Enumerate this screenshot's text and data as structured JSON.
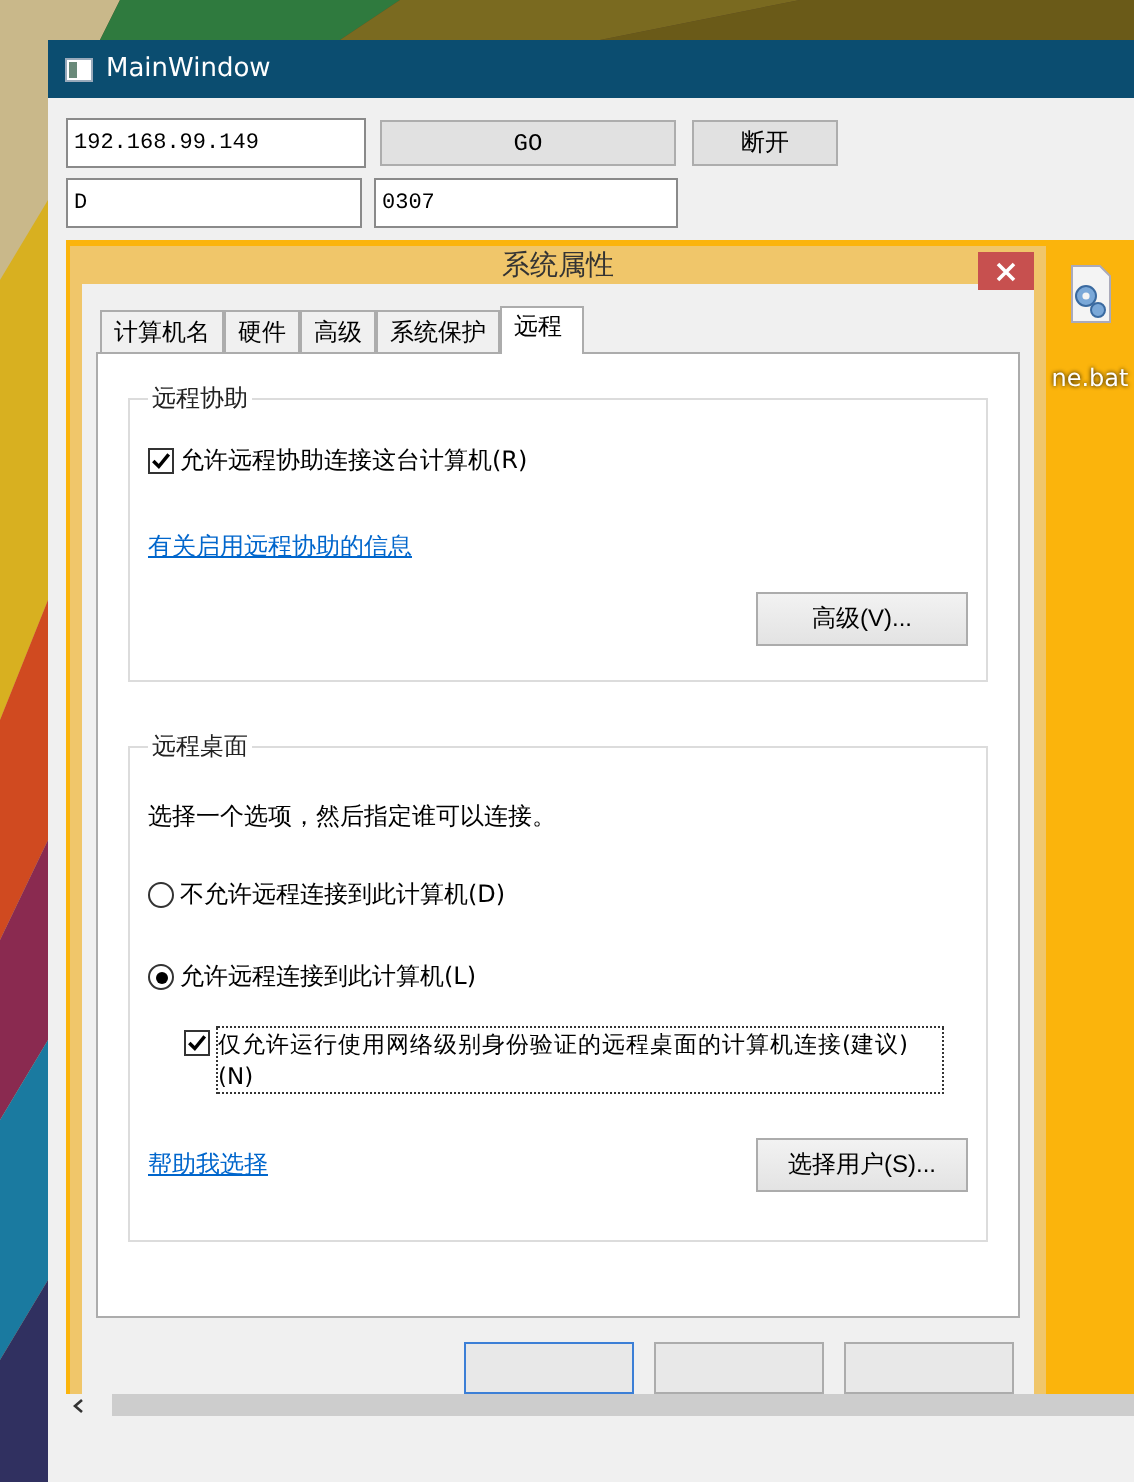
{
  "main_window": {
    "title": "MainWindow",
    "host_field": {
      "value": "192.168.99.149"
    },
    "go_button": "GO",
    "disconnect_button": "断开",
    "field_2": {
      "value": "D"
    },
    "field_3": {
      "value": "0307"
    },
    "remote_screen": {
      "dialog": {
        "title": "系统属性",
        "tabs": [
          {
            "label": "计算机名",
            "selected": false
          },
          {
            "label": "硬件",
            "selected": false
          },
          {
            "label": "高级",
            "selected": false
          },
          {
            "label": "系统保护",
            "selected": false
          },
          {
            "label": "远程",
            "selected": true
          }
        ],
        "remote_assistance": {
          "title": "远程协助",
          "allow": {
            "label": "允许远程协助连接这台计算机(R)",
            "checked": true
          },
          "info_link": "有关启用远程协助的信息",
          "advanced_button": "高级(V)..."
        },
        "remote_desktop": {
          "title": "远程桌面",
          "instruction": "选择一个选项，然后指定谁可以连接。",
          "options": [
            {
              "label": "不允许远程连接到此计算机(D)",
              "selected": false
            },
            {
              "label": "允许远程连接到此计算机(L)",
              "selected": true
            }
          ],
          "nla": {
            "label": "仅允许运行使用网络级别身份验证的远程桌面的计算机连接(建议)(N)",
            "checked": true
          },
          "help_link": "帮助我选择",
          "select_users_button": "选择用户(S)..."
        },
        "footer_buttons": [
          {
            "default": true
          },
          {
            "default": false
          },
          {
            "default": false
          }
        ]
      },
      "desktop_icon": {
        "label": "ne.bat"
      }
    }
  }
}
